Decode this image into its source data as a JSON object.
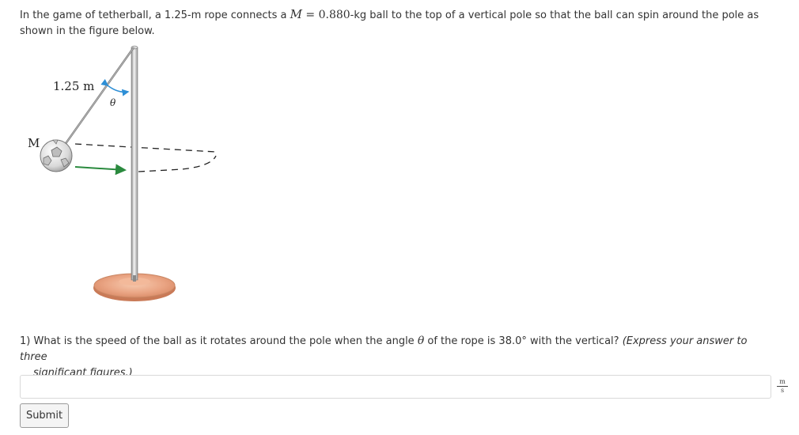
{
  "problem": {
    "intro_part1": "In the game of tetherball, a 1.25-m rope connects a ",
    "mass_symbol": "M",
    "mass_equals": " = 0.880",
    "intro_part2": "-kg ball to the top of a vertical pole so that the ball can spin around the pole as shown in the figure below."
  },
  "figure": {
    "rope_length_label": "1.25 m",
    "mass_label": "M",
    "angle_label": "θ"
  },
  "question": {
    "number": "1)",
    "text_part1": " What is the speed of the ball as it rotates around the pole when the angle ",
    "theta": "θ",
    "text_part2": " of the rope is 38.0° with the vertical? ",
    "instruction_line1": "(Express your answer to three",
    "instruction_line2": "significant figures.)"
  },
  "answer": {
    "value": "",
    "placeholder": "",
    "unit_numerator": "m",
    "unit_denominator": "s"
  },
  "submit_label": "Submit",
  "colors": {
    "text": "#333333",
    "theta_arrow": "#2e8fd6",
    "motion_arrow": "#2a8a3e",
    "base": "#e8a07e"
  }
}
